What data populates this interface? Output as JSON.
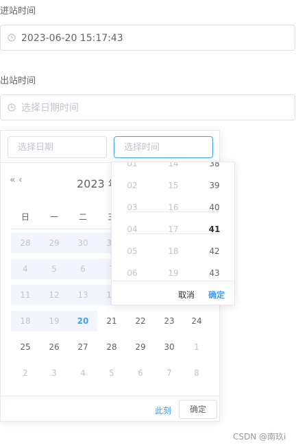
{
  "entry": {
    "label": "进站时间",
    "value": "2023-06-20 15:17:43"
  },
  "exit": {
    "label": "出站时间",
    "placeholder": "选择日期时间"
  },
  "picker": {
    "date_placeholder": "选择日期",
    "time_placeholder": "选择时间",
    "nav_prev_year": "«",
    "nav_prev_month": "‹",
    "year_label": "2023 年",
    "weekdays": [
      "日",
      "一",
      "二",
      "三"
    ],
    "rows": [
      [
        "28",
        "29",
        "30",
        "31"
      ],
      [
        "4",
        "5",
        "6",
        "7"
      ],
      [
        "11",
        "12",
        "13",
        "14"
      ],
      [
        "18",
        "19",
        "20",
        "21",
        "22",
        "23",
        "24"
      ],
      [
        "25",
        "26",
        "27",
        "28",
        "29",
        "30",
        "1"
      ],
      [
        "2",
        "3",
        "4",
        "5",
        "6",
        "7",
        "8"
      ]
    ],
    "today": "20",
    "now_button": "此刻",
    "ok_button": "确定"
  },
  "time_panel": {
    "hours": [
      "01",
      "02",
      "03",
      "04",
      "05",
      "06"
    ],
    "minutes": [
      "14",
      "15",
      "16",
      "17",
      "18",
      "19"
    ],
    "seconds": [
      "38",
      "39",
      "40",
      "41",
      "42",
      "43"
    ],
    "selected_second": "41",
    "cancel": "取消",
    "confirm": "确定"
  },
  "colors": {
    "accent": "#409eff",
    "muted": "#c0c4cc",
    "band": "#f2f6fc"
  },
  "watermark": "CSDN @南玖i"
}
